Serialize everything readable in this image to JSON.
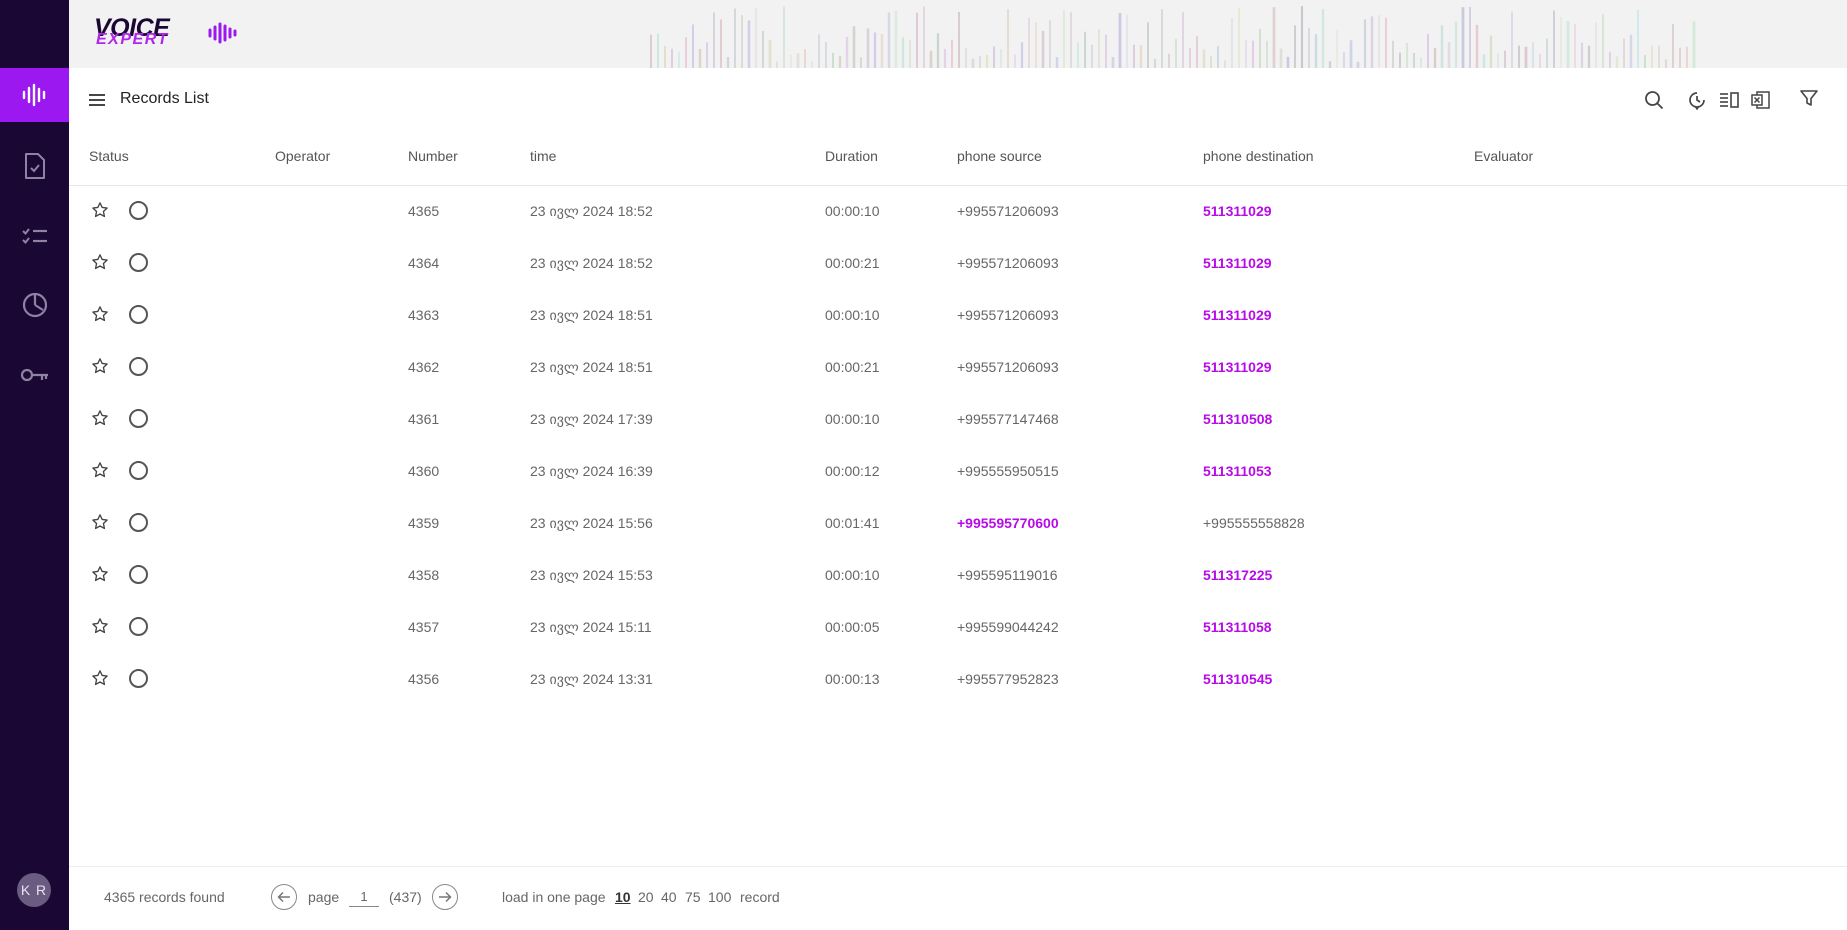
{
  "brand": {
    "line1": "VOICE",
    "line2": "EXPERT"
  },
  "header": {
    "title": "Records List"
  },
  "user": {
    "initials": "K R"
  },
  "columns": {
    "status": "Status",
    "operator": "Operator",
    "number": "Number",
    "time": "time",
    "duration": "Duration",
    "source": "phone source",
    "destination": "phone destination",
    "evaluator": "Evaluator"
  },
  "rows": [
    {
      "number": "4365",
      "time": "23 ივლ 2024 18:52",
      "duration": "00:00:10",
      "source": "+995571206093",
      "destination": "511311029",
      "accent": "destination"
    },
    {
      "number": "4364",
      "time": "23 ივლ 2024 18:52",
      "duration": "00:00:21",
      "source": "+995571206093",
      "destination": "511311029",
      "accent": "destination"
    },
    {
      "number": "4363",
      "time": "23 ივლ 2024 18:51",
      "duration": "00:00:10",
      "source": "+995571206093",
      "destination": "511311029",
      "accent": "destination"
    },
    {
      "number": "4362",
      "time": "23 ივლ 2024 18:51",
      "duration": "00:00:21",
      "source": "+995571206093",
      "destination": "511311029",
      "accent": "destination"
    },
    {
      "number": "4361",
      "time": "23 ივლ 2024 17:39",
      "duration": "00:00:10",
      "source": "+995577147468",
      "destination": "511310508",
      "accent": "destination"
    },
    {
      "number": "4360",
      "time": "23 ივლ 2024 16:39",
      "duration": "00:00:12",
      "source": "+995555950515",
      "destination": "511311053",
      "accent": "destination"
    },
    {
      "number": "4359",
      "time": "23 ივლ 2024 15:56",
      "duration": "00:01:41",
      "source": "+995595770600",
      "destination": "+995555558828",
      "accent": "source"
    },
    {
      "number": "4358",
      "time": "23 ივლ 2024 15:53",
      "duration": "00:00:10",
      "source": "+995595119016",
      "destination": "511317225",
      "accent": "destination"
    },
    {
      "number": "4357",
      "time": "23 ივლ 2024 15:11",
      "duration": "00:00:05",
      "source": "+995599044242",
      "destination": "511311058",
      "accent": "destination"
    },
    {
      "number": "4356",
      "time": "23 ივლ 2024 13:31",
      "duration": "00:00:13",
      "source": "+995577952823",
      "destination": "511310545",
      "accent": "destination"
    }
  ],
  "footer": {
    "records_found": "4365 records found",
    "page_label": "page",
    "page_value": "1",
    "total_pages": "(437)",
    "load_label": "load in one page",
    "page_sizes": [
      "10",
      "20",
      "40",
      "75",
      "100"
    ],
    "active_size": "10",
    "record_label": "record"
  },
  "colors": {
    "sidebar": "#1a0733",
    "accent": "#9b19f0",
    "link": "#b80ae8"
  }
}
